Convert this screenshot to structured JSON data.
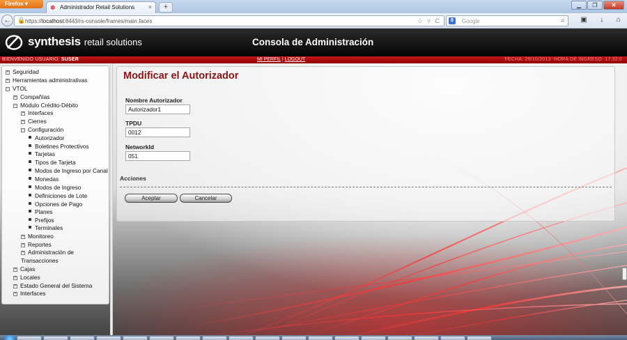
{
  "browser": {
    "menu_button": "Firefox",
    "tab_title": "Administrador Retail Solutions",
    "new_tab": "+",
    "url_prefix": "https://",
    "url_host": "localhost",
    "url_rest": ":8443/rs-console/frames/main.faces",
    "search_placeholder": "Google",
    "back_glyph": "←"
  },
  "header": {
    "logo_brand": "synthesis",
    "logo_sub": "retail solutions",
    "console_title": "Consola de Administración"
  },
  "status_bar": {
    "welcome_label": "BIENVENIDO USUARIO:",
    "username": "SUSER",
    "profile_link": "MI PERFIL",
    "separator": "|",
    "logout_link": "LOGOUT",
    "date_info": "FECHA: 29/10/2013 -HORA DE INGRESO: 17:32:0"
  },
  "sidebar": {
    "items": [
      {
        "label": "Seguridad",
        "toggle": "+"
      },
      {
        "label": "Herramientas administrativas",
        "toggle": "+"
      },
      {
        "label": "VTOL",
        "toggle": "−"
      },
      {
        "label": "Compañías",
        "toggle": "+"
      },
      {
        "label": "Módulo Crédito-Débito",
        "toggle": "−"
      },
      {
        "label": "Interfaces",
        "toggle": "+"
      },
      {
        "label": "Cierres",
        "toggle": "+"
      },
      {
        "label": "Configuración",
        "toggle": "−"
      },
      {
        "label": "Autorizador"
      },
      {
        "label": "Boletines Protectivos"
      },
      {
        "label": "Tarjetas"
      },
      {
        "label": "Tipos de Tarjeta"
      },
      {
        "label": "Modos de Ingreso por Canal"
      },
      {
        "label": "Monedas"
      },
      {
        "label": "Modos de Ingreso"
      },
      {
        "label": "Definiciones de Lote"
      },
      {
        "label": "Opciones de Pago"
      },
      {
        "label": "Planes"
      },
      {
        "label": "Prefijos"
      },
      {
        "label": "Terminales"
      },
      {
        "label": "Monitoreo",
        "toggle": "+"
      },
      {
        "label": "Reportes",
        "toggle": "+"
      },
      {
        "label": "Administración de",
        "toggle": "+"
      },
      {
        "label": "Transacciones"
      },
      {
        "label": "Cajas",
        "toggle": "+"
      },
      {
        "label": "Locales",
        "toggle": "+"
      },
      {
        "label": "Estado General del Sistema",
        "toggle": "+"
      },
      {
        "label": "Interfaces",
        "toggle": "+"
      }
    ]
  },
  "form": {
    "title": "Modificar el Autorizador",
    "fields": [
      {
        "label": "Nombre Autorizador",
        "value": "Autorizador1"
      },
      {
        "label": "TPDU",
        "value": "0012"
      },
      {
        "label": "NetworkId",
        "value": "051"
      }
    ],
    "actions_title": "Acciones",
    "accept_label": "Aceptar",
    "cancel_label": "Cancelar"
  },
  "colors": {
    "brand_red": "#b00000",
    "title_red": "#8b1212",
    "header_black": "#050505"
  },
  "icons": {
    "lock": "lock-icon",
    "star": "bookmark-star-icon",
    "reload": "reload-icon",
    "search": "search-icon",
    "download": "download-icon",
    "home": "home-icon"
  }
}
